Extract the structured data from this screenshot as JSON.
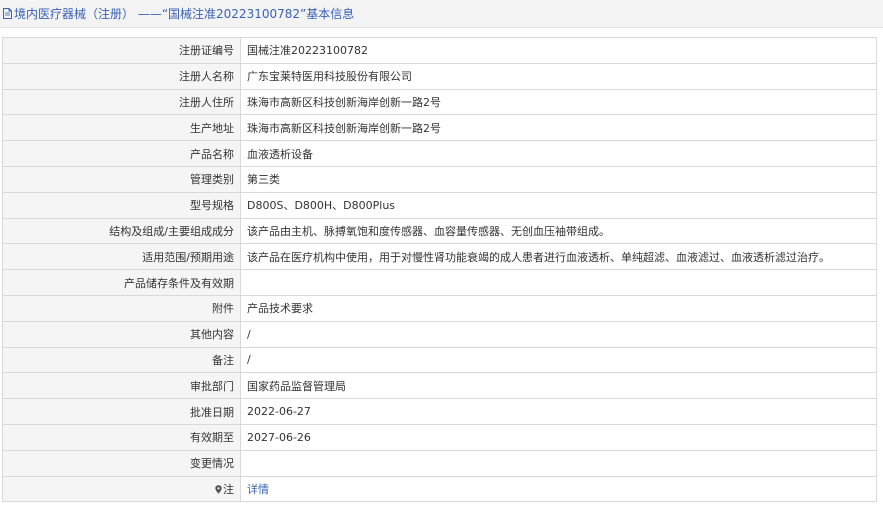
{
  "header": {
    "title": "境内医疗器械（注册） ——“国械注准20223100782”基本信息"
  },
  "rows": [
    {
      "label": "注册证编号",
      "value": "国械注准20223100782"
    },
    {
      "label": "注册人名称",
      "value": "广东宝莱特医用科技股份有限公司"
    },
    {
      "label": "注册人住所",
      "value": "珠海市高新区科技创新海岸创新一路2号"
    },
    {
      "label": "生产地址",
      "value": "珠海市高新区科技创新海岸创新一路2号"
    },
    {
      "label": "产品名称",
      "value": "血液透析设备"
    },
    {
      "label": "管理类别",
      "value": "第三类"
    },
    {
      "label": "型号规格",
      "value": "D800S、D800H、D800Plus"
    },
    {
      "label": "结构及组成/主要组成成分",
      "value": "该产品由主机、脉搏氧饱和度传感器、血容量传感器、无创血压袖带组成。"
    },
    {
      "label": "适用范围/预期用途",
      "value": "该产品在医疗机构中使用，用于对慢性肾功能衰竭的成人患者进行血液透析、单纯超滤、血液滤过、血液透析滤过治疗。"
    },
    {
      "label": "产品储存条件及有效期",
      "value": ""
    },
    {
      "label": "附件",
      "value": "产品技术要求"
    },
    {
      "label": "其他内容",
      "value": "/"
    },
    {
      "label": "备注",
      "value": "/"
    },
    {
      "label": "审批部门",
      "value": "国家药品监督管理局"
    },
    {
      "label": "批准日期",
      "value": "2022-06-27"
    },
    {
      "label": "有效期至",
      "value": "2027-06-26"
    },
    {
      "label": "变更情况",
      "value": ""
    }
  ],
  "note": {
    "label": "注",
    "link_text": "详情",
    "icon": "pin-icon"
  },
  "colors": {
    "link": "#3a62b4",
    "label_bg": "#f5f5f5",
    "border": "#d9d9d9",
    "header_bg": "#f3f3f3"
  }
}
